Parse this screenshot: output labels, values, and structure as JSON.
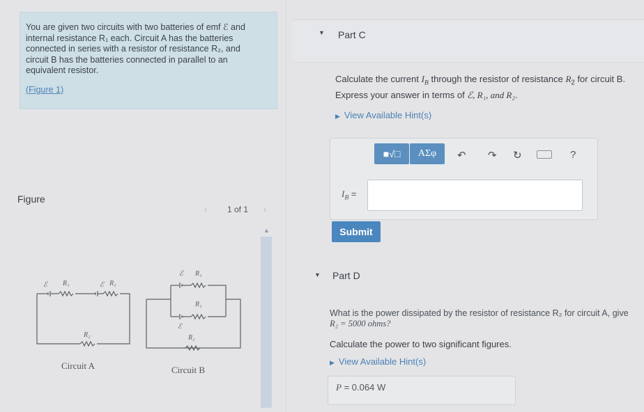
{
  "problem": {
    "lines": [
      "You are given two circuits with two batteries of emf ℰ and",
      "internal resistance R₁ each. Circuit A has the batteries",
      "connected in series with a resistor of resistance R₂, and",
      "circuit B has the batteries connected in parallel to an",
      "equivalent resistor."
    ],
    "figure_link": "(Figure 1)"
  },
  "figure": {
    "label": "Figure",
    "pager": "1 of 1",
    "prev_icon": "chevron-left",
    "next_icon": "chevron-right",
    "circuit_a": {
      "caption": "Circuit A",
      "labels": [
        "ℰ",
        "R₁",
        "ℰ",
        "R₁",
        "R₂"
      ]
    },
    "circuit_b": {
      "caption": "Circuit B",
      "labels": [
        "ℰ",
        "R₁",
        "R₁",
        "ℰ",
        "R₂"
      ]
    }
  },
  "part_c": {
    "title": "Part C",
    "question_pre": "Calculate the current ",
    "question_var": "I",
    "question_var_sub": "B",
    "question_mid": " through the resistor of resistance ",
    "question_r": "R",
    "question_r_sub": "2",
    "question_post": " for circuit B.",
    "express_pre": "Express your answer in terms of ",
    "express_vars": "ℰ, R₁, and R₂",
    "express_post": ".",
    "hint": "View Available Hint(s)",
    "toolbar": {
      "templates_label": "■√□",
      "symbols_label": "ΑΣφ",
      "undo_icon": "undo",
      "redo_icon": "redo",
      "reset_icon": "reset",
      "keyboard_icon": "keyboard",
      "help_label": "?"
    },
    "answer_label": "I",
    "answer_label_sub": "B",
    "answer_label_post": " =",
    "answer_value": "",
    "submit": "Submit"
  },
  "part_d": {
    "title": "Part D",
    "question_line1": "What is the power dissipated by the resistor of resistance R₂ for circuit A, give",
    "question_line2": "R₂ = 5000 ohms?",
    "calc": "Calculate the power to two significant figures.",
    "hint": "View Available Hint(s)",
    "answer_label": "P",
    "answer_eq": " = ",
    "answer_value": "0.064",
    "answer_unit": " W"
  },
  "colors": {
    "problem_bg": "#cfdfe6",
    "link": "#4a82b5",
    "button": "#4b87bf",
    "toolbar_button": "#5a8fbf",
    "page_bg": "#e4e4e6"
  }
}
